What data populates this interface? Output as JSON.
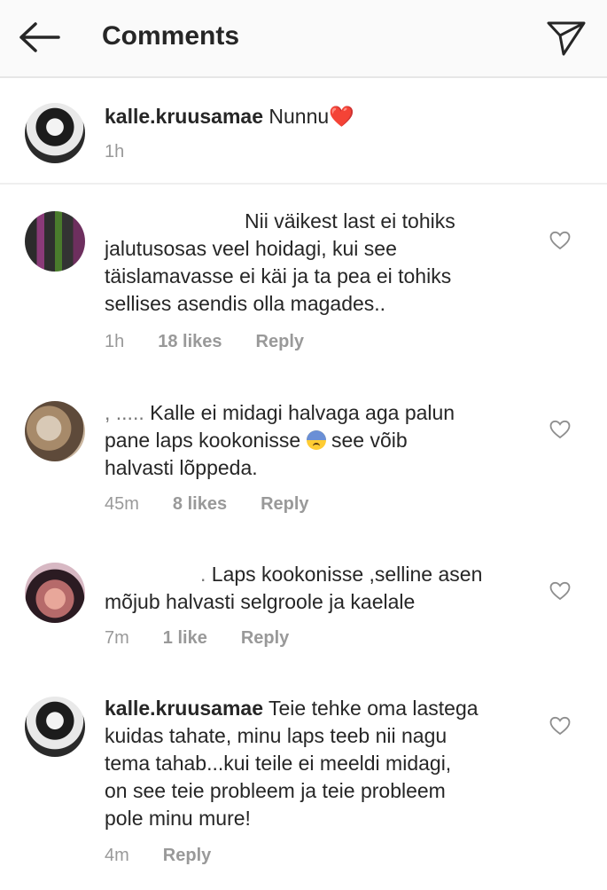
{
  "header": {
    "title": "Comments",
    "back_icon": "arrow-left-icon",
    "send_icon": "paper-plane-icon"
  },
  "caption": {
    "username": "kalle.kruusamae",
    "text": "Nunnu",
    "emoji": "❤️",
    "time": "1h"
  },
  "comments": [
    {
      "username": "",
      "text_lines": [
        "Nii väikest last ei tohiks",
        "jalutusosas veel hoidagi, kui see",
        "täislamavasse ei käi ja ta pea ei tohiks",
        "sellises asendis olla magades.."
      ],
      "time": "1h",
      "likes": "18 likes",
      "reply": "Reply"
    },
    {
      "username": "",
      "prefix": ", ..... ",
      "text_line1": "Kalle ei midagi halvaga aga palun",
      "text_line2a": "pane laps kookonisse",
      "text_line2b": "see võib",
      "text_line3": "halvasti lõppeda.",
      "time": "45m",
      "likes": "8 likes",
      "reply": "Reply"
    },
    {
      "username": "",
      "prefix": ". ",
      "text_lines": [
        "Laps kookonisse ,selline asen",
        "mõjub halvasti selgroole ja kaelale"
      ],
      "time": "7m",
      "likes": "1 like",
      "reply": "Reply"
    },
    {
      "username": "kalle.kruusamae",
      "text_lines": [
        "Teie tehke oma lastega",
        "kuidas tahate, minu laps teeb nii nagu",
        "tema tahab...kui teile ei meeldi midagi,",
        "on see teie probleem ja teie probleem",
        "pole minu mure!"
      ],
      "time": "4m",
      "reply": "Reply"
    }
  ],
  "colors": {
    "text": "#262626",
    "meta": "#999999",
    "heart_red": "#ed4956",
    "header_bg": "#fafafa"
  }
}
